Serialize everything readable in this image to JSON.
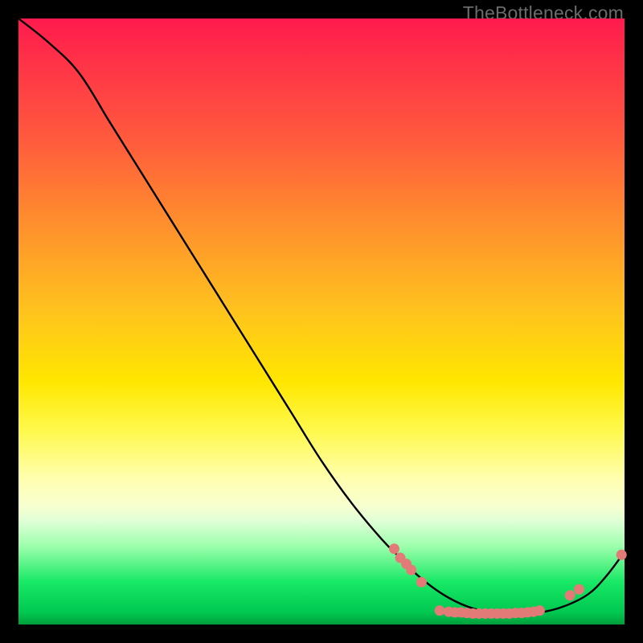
{
  "watermark": "TheBottleneck.com",
  "chart_data": {
    "type": "line",
    "title": "",
    "xlabel": "",
    "ylabel": "",
    "xlim": [
      0,
      100
    ],
    "ylim": [
      0,
      100
    ],
    "series": [
      {
        "name": "bottleneck-curve",
        "x": [
          0,
          5,
          10,
          15,
          20,
          25,
          30,
          35,
          40,
          45,
          50,
          55,
          60,
          63,
          66,
          70,
          74,
          78,
          82,
          86,
          90,
          94,
          97,
          100
        ],
        "y": [
          100,
          96,
          91,
          83,
          75,
          67,
          59,
          51,
          43,
          35,
          27,
          20,
          14,
          11,
          8,
          5,
          3,
          2,
          2,
          2,
          3,
          5,
          8,
          12
        ]
      }
    ],
    "highlight_points": {
      "name": "marker-dots",
      "color": "#e27b78",
      "points": [
        {
          "x": 62.0,
          "y": 12.5
        },
        {
          "x": 63.0,
          "y": 11.0
        },
        {
          "x": 64.0,
          "y": 10.0
        },
        {
          "x": 64.8,
          "y": 9.0
        },
        {
          "x": 66.5,
          "y": 7.0
        },
        {
          "x": 69.5,
          "y": 2.3
        },
        {
          "x": 71.0,
          "y": 2.1
        },
        {
          "x": 72.0,
          "y": 2.0
        },
        {
          "x": 73.0,
          "y": 2.0
        },
        {
          "x": 74.0,
          "y": 1.9
        },
        {
          "x": 75.0,
          "y": 1.8
        },
        {
          "x": 76.0,
          "y": 1.8
        },
        {
          "x": 77.0,
          "y": 1.8
        },
        {
          "x": 78.0,
          "y": 1.8
        },
        {
          "x": 79.0,
          "y": 1.8
        },
        {
          "x": 80.0,
          "y": 1.8
        },
        {
          "x": 81.0,
          "y": 1.8
        },
        {
          "x": 82.0,
          "y": 1.9
        },
        {
          "x": 83.0,
          "y": 1.9
        },
        {
          "x": 84.0,
          "y": 2.0
        },
        {
          "x": 85.0,
          "y": 2.1
        },
        {
          "x": 86.0,
          "y": 2.3
        },
        {
          "x": 91.0,
          "y": 4.8
        },
        {
          "x": 92.5,
          "y": 5.8
        },
        {
          "x": 99.5,
          "y": 11.5
        }
      ]
    }
  }
}
